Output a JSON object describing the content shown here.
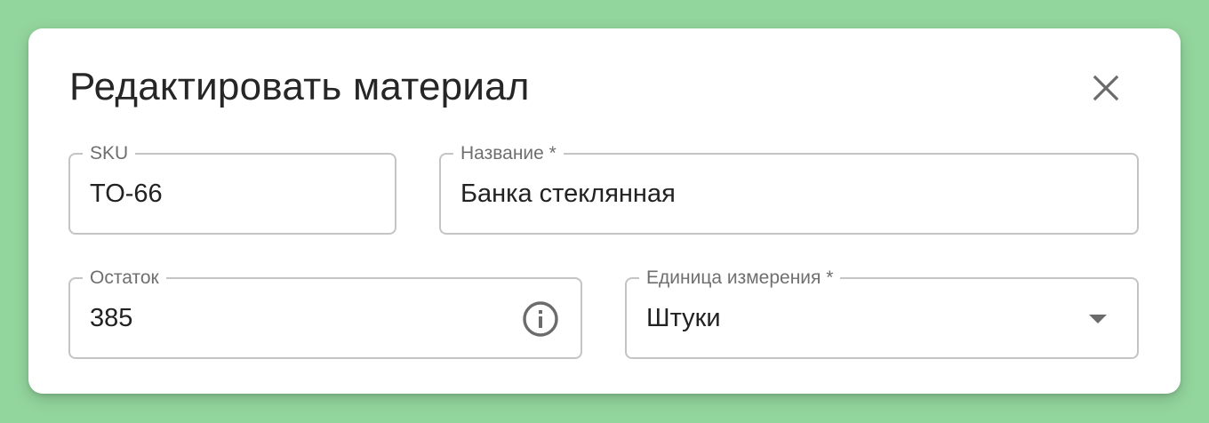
{
  "dialog": {
    "title": "Редактировать материал",
    "close_icon": "close-icon"
  },
  "fields": {
    "sku": {
      "label": "SKU",
      "value": "TO-66"
    },
    "name": {
      "label": "Название *",
      "value": "Банка стеклянная"
    },
    "stock": {
      "label": "Остаток",
      "value": "385",
      "icon": "info-icon"
    },
    "unit": {
      "label": "Единица измерения *",
      "value": "Штуки",
      "icon": "dropdown-arrow-icon"
    }
  },
  "colors": {
    "background": "#93d69d",
    "dialog": "#ffffff",
    "border": "#c4c4c4",
    "label": "#6f6f6f",
    "text": "#222222"
  }
}
